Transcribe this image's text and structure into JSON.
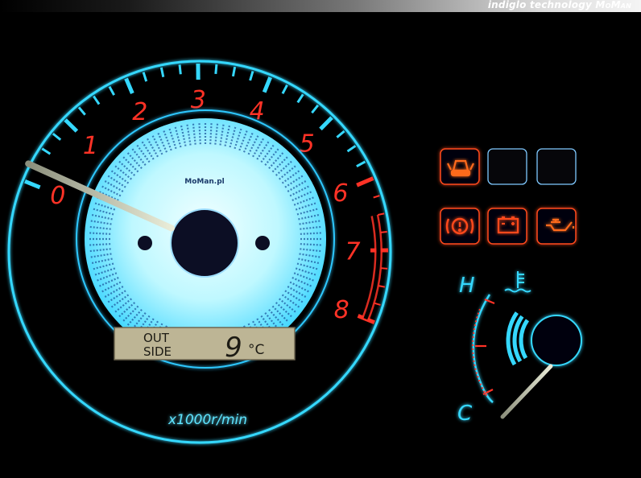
{
  "banner": {
    "tagline": "indiglo technology",
    "brand": "MoMan"
  },
  "tachometer": {
    "dial_labels": [
      "0",
      "1",
      "2",
      "3",
      "4",
      "5",
      "6",
      "7",
      "8"
    ],
    "unit_label": "x1000r/min",
    "center_logo": "MoMan.pl",
    "needle_value": 0.1,
    "redline_from": 6
  },
  "lcd": {
    "line1": "OUT",
    "line2": "SIDE",
    "value": "9",
    "unit": "°C"
  },
  "warning_lights": [
    {
      "name": "door-ajar",
      "lit": true
    },
    {
      "name": "blank",
      "lit": false
    },
    {
      "name": "blank",
      "lit": false
    },
    {
      "name": "brake",
      "lit": true
    },
    {
      "name": "battery",
      "lit": true
    },
    {
      "name": "oil-pressure",
      "lit": true
    }
  ],
  "temp_gauge": {
    "hot_label": "H",
    "cold_label": "C",
    "level": 0.15
  },
  "colors": {
    "glow": "#35d8ff",
    "label_red": "#ff3226",
    "face": "#c8ffff",
    "warning": "#ff4a1a"
  }
}
